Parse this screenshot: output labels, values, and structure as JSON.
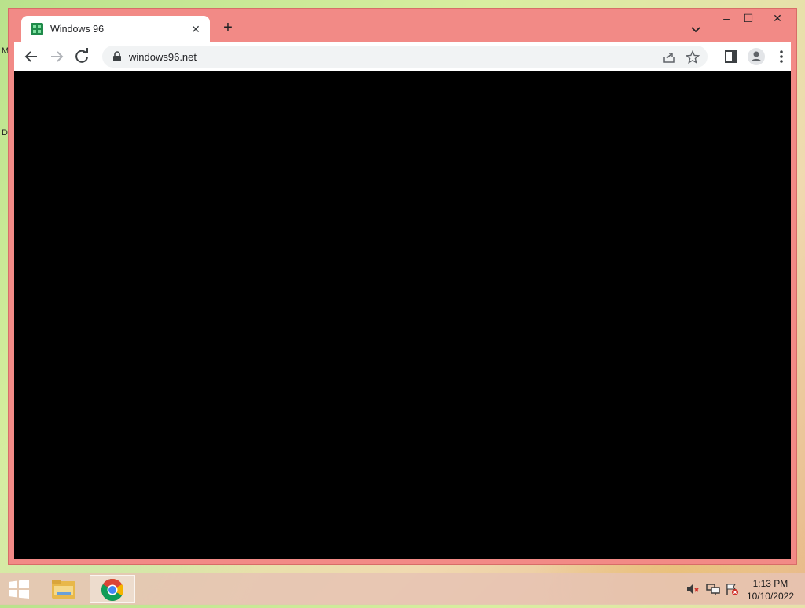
{
  "desktop": {
    "fragment_top": "M",
    "fragment_mid": "D"
  },
  "window": {
    "tab": {
      "title": "Windows 96",
      "favicon": "windows96-favicon-icon"
    },
    "new_tab": "+",
    "controls": {
      "minimize": "–",
      "maximize": "☐",
      "close": "✕"
    }
  },
  "toolbar": {
    "url": "windows96.net",
    "icons": [
      "back-arrow-icon",
      "forward-arrow-icon",
      "reload-icon",
      "lock-icon",
      "share-icon",
      "star-icon",
      "side-panel-icon",
      "profile-icon",
      "kebab-menu-icon"
    ]
  },
  "viewport": {
    "background": "#000000"
  },
  "taskbar": {
    "pinned": [
      "file-explorer-icon",
      "chrome-icon"
    ],
    "tray": [
      "volume-muted-icon",
      "network-icon",
      "action-center-flag-icon"
    ],
    "time": "1:13 PM",
    "date": "10/10/2022"
  },
  "colors": {
    "title_bar": "#f28a86",
    "toolbar": "#ffffff",
    "content": "#000000"
  }
}
